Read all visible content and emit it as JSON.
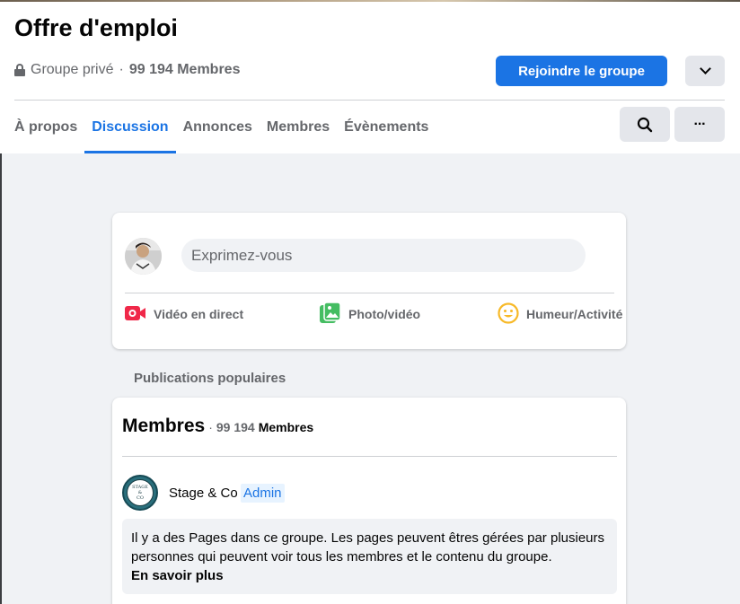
{
  "group": {
    "title": "Offre d'emploi",
    "privacy": "Groupe privé",
    "separator": "·",
    "member_count": "99 194 Membres"
  },
  "actions": {
    "join_label": "Rejoindre le groupe",
    "more_label": "···"
  },
  "tabs": [
    {
      "label": "À propos",
      "active": false
    },
    {
      "label": "Discussion",
      "active": true
    },
    {
      "label": "Annonces",
      "active": false
    },
    {
      "label": "Membres",
      "active": false
    },
    {
      "label": "Évènements",
      "active": false
    }
  ],
  "composer": {
    "placeholder": "Exprimez-vous",
    "live_label": "Vidéo en direct",
    "photo_label": "Photo/vidéo",
    "mood_label": "Humeur/Activité"
  },
  "feed": {
    "section_label": "Publications populaires"
  },
  "members_card": {
    "title": "Membres",
    "separator": "·",
    "count": "99 194",
    "count_label": "Membres",
    "member": {
      "name": "Stage & Co",
      "badge": "Admin"
    },
    "info_text": "Il y a des Pages dans ce groupe. Les pages peuvent êtres gérées par plusieurs personnes qui peuvent voir tous les membres et le contenu du groupe.",
    "learn_more": "En savoir plus"
  },
  "colors": {
    "accent": "#1b74e4",
    "live": "#f02849",
    "photo": "#45bd62",
    "mood": "#f7b928"
  },
  "icons": [
    "lock-icon",
    "chevron-down-icon",
    "search-icon",
    "live-video-icon",
    "photo-video-icon",
    "mood-icon"
  ]
}
